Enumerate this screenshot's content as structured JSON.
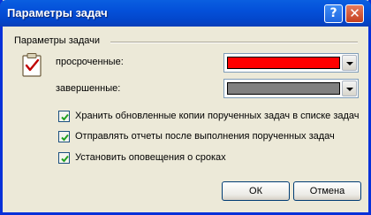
{
  "window": {
    "title": "Параметры задач",
    "help_button_glyph": "?",
    "close_button_glyph": "✕"
  },
  "group": {
    "label": "Параметры задачи",
    "icon": "task-clipboard-icon"
  },
  "color_settings": [
    {
      "label": "просроченные:",
      "color": "#ff0000"
    },
    {
      "label": "завершенные:",
      "color": "#808080"
    }
  ],
  "checkboxes": [
    {
      "label": "Хранить обновленные копии порученных задач в списке задач",
      "checked": true
    },
    {
      "label": "Отправлять отчеты после выполнения порученных задач",
      "checked": true
    },
    {
      "label": "Установить оповещения о сроках",
      "checked": true
    }
  ],
  "buttons": {
    "ok_label": "ОК",
    "cancel_label": "Отмена"
  }
}
